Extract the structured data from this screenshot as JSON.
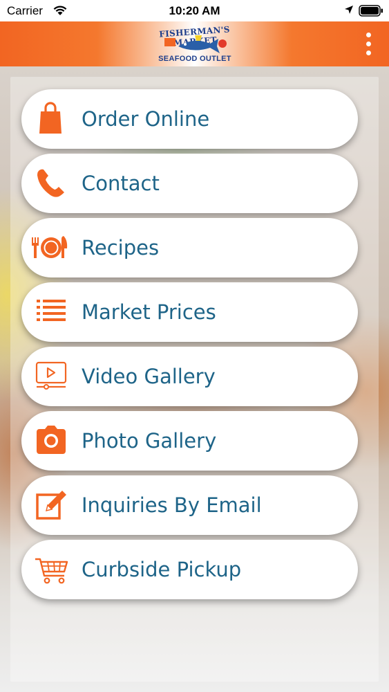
{
  "status_bar": {
    "carrier": "Carrier",
    "time": "10:20 AM"
  },
  "header": {
    "logo_top": "FISHERMAN'S MARKET",
    "logo_bottom": "SEAFOOD OUTLET",
    "menu_icon": "more-vertical-icon"
  },
  "colors": {
    "accent": "#f26522",
    "label": "#1e6488"
  },
  "menu": {
    "items": [
      {
        "label": "Order Online",
        "icon": "shopping-bag-icon"
      },
      {
        "label": "Contact",
        "icon": "phone-icon"
      },
      {
        "label": "Recipes",
        "icon": "plate-utensils-icon"
      },
      {
        "label": "Market Prices",
        "icon": "list-icon"
      },
      {
        "label": "Video Gallery",
        "icon": "video-icon"
      },
      {
        "label": "Photo Gallery",
        "icon": "camera-icon"
      },
      {
        "label": "Inquiries By Email",
        "icon": "edit-icon"
      },
      {
        "label": "Curbside Pickup",
        "icon": "cart-icon"
      }
    ]
  }
}
